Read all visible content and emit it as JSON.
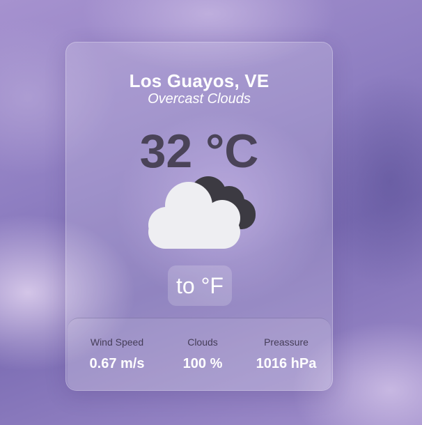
{
  "weather": {
    "location": "Los Guayos, VE",
    "description": "Overcast Clouds",
    "temperature": "32 °C",
    "icon": "overcast-clouds-icon"
  },
  "unit_toggle": {
    "label": "to °F"
  },
  "stats": [
    {
      "label": "Wind Speed",
      "value": "0.67 m/s"
    },
    {
      "label": "Clouds",
      "value": "100 %"
    },
    {
      "label": "Preassure",
      "value": "1016 hPa"
    }
  ],
  "colors": {
    "temperature_text": "#4a4358",
    "label_text": "#453d58",
    "value_text": "#ffffff",
    "front_cloud": "#eeeef2",
    "back_cloud": "#3c3a42"
  }
}
